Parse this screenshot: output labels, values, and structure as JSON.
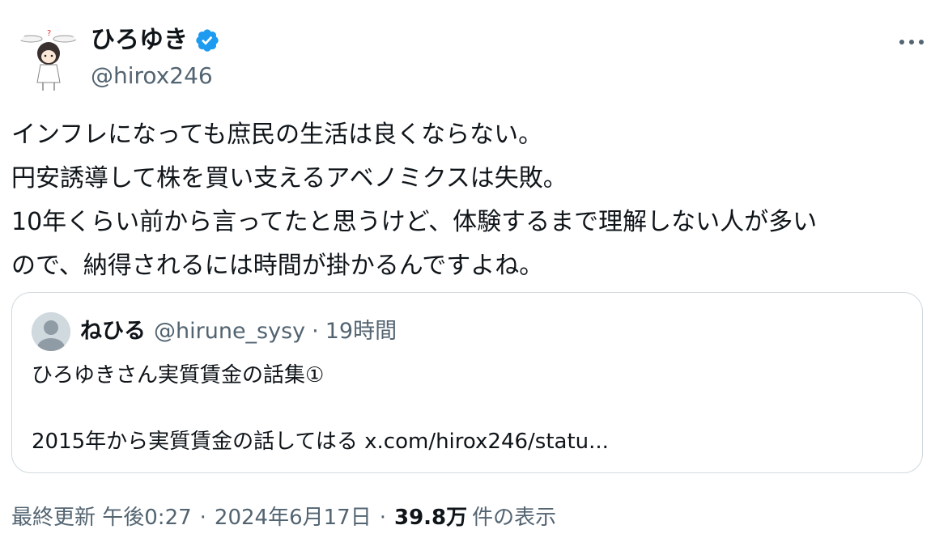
{
  "author": {
    "display_name": "ひろゆき",
    "handle": "@hirox246",
    "verified": true,
    "avatar_icon": "bunny-ear-character-avatar"
  },
  "more_icon": "more-horizontal-icon",
  "tweet": {
    "lines": [
      "インフレになっても庶民の生活は良くならない。",
      "円安誘導して株を買い支えるアベノミクスは失敗。",
      "10年くらい前から言ってたと思うけど、体験するまで理解しない人が多い",
      "ので、納得されるには時間が掛かるんですよね。"
    ]
  },
  "quoted": {
    "display_name": "ねひる",
    "handle": "@hirune_sysy",
    "separator": "·",
    "time": "19時間",
    "line1": "ひろゆきさん実質賃金の話集①",
    "line2_text": "2015年から実質賃金の話してはる ",
    "line2_link": "x.com/hirox246/statu..."
  },
  "meta": {
    "updated_label": "最終更新 午後0:27",
    "sep1": "·",
    "date": "2024年6月17日",
    "sep2": "·",
    "views_count": "39.8万",
    "views_label": "件の表示"
  },
  "colors": {
    "text": "#0f1419",
    "secondary": "#536471",
    "verified_blue": "#1d9bf0",
    "border": "#cfd9de"
  }
}
